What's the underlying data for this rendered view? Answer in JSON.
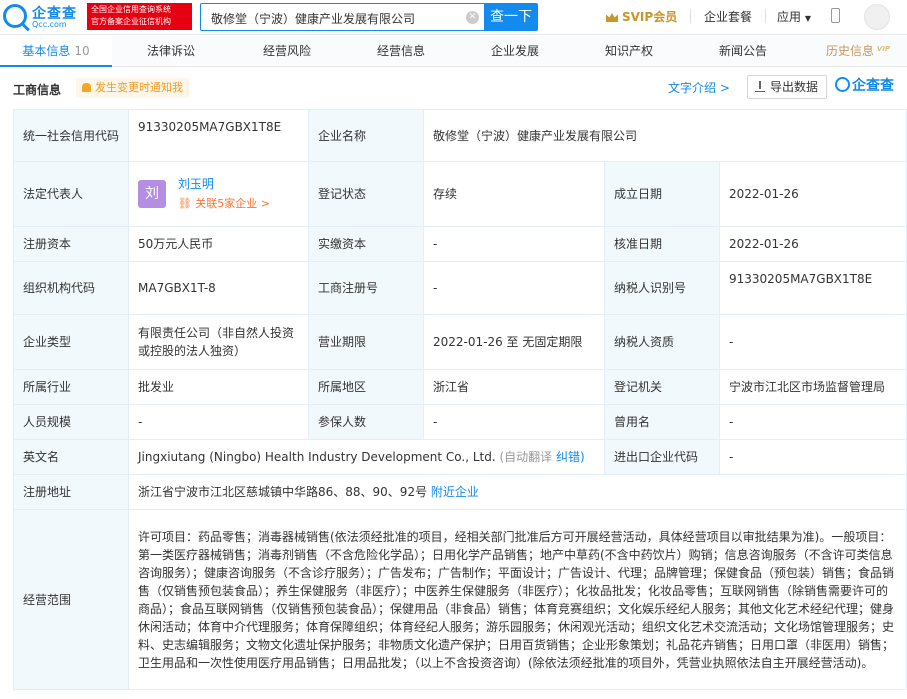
{
  "header": {
    "logo_name": "企查查",
    "logo_sub": "Qcc.com",
    "badge_line1": "全国企业信用查询系统",
    "badge_line2": "官方备案企业征信机构",
    "search_value": "敬修堂（宁波）健康产业发展有限公司",
    "search_button": "查一下",
    "svip": "SVIP会员",
    "enterprise_suite": "企业套餐",
    "apps": "应用"
  },
  "tabs": [
    {
      "label": "基本信息",
      "count": "10"
    },
    {
      "label": "法律诉讼"
    },
    {
      "label": "经营风险"
    },
    {
      "label": "经营信息"
    },
    {
      "label": "企业发展"
    },
    {
      "label": "知识产权"
    },
    {
      "label": "新闻公告"
    },
    {
      "label": "历史信息",
      "vip": "VIP"
    }
  ],
  "section": {
    "title": "工商信息",
    "notify": "发生变更时通知我",
    "text_intro": "文字介绍 >",
    "export": "导出数据",
    "brand": "企查查"
  },
  "info": {
    "credit_code_label": "统一社会信用代码",
    "credit_code": "91330205MA7GBX1T8E",
    "company_name_label": "企业名称",
    "company_name": "敬修堂（宁波）健康产业发展有限公司",
    "legal_rep_label": "法定代表人",
    "legal_rep_avatar": "刘",
    "legal_rep_name": "刘玉明",
    "legal_rep_related": "关联5家企业 >",
    "reg_status_label": "登记状态",
    "reg_status": "存续",
    "founded_label": "成立日期",
    "founded": "2022-01-26",
    "reg_capital_label": "注册资本",
    "reg_capital": "50万元人民币",
    "paid_capital_label": "实缴资本",
    "paid_capital": "-",
    "approved_label": "核准日期",
    "approved": "2022-01-26",
    "org_code_label": "组织机构代码",
    "org_code": "MA7GBX1T-8",
    "reg_no_label": "工商注册号",
    "reg_no": "-",
    "taxpayer_id_label": "纳税人识别号",
    "taxpayer_id": "91330205MA7GBX1T8E",
    "type_label": "企业类型",
    "type": "有限责任公司（非自然人投资或控股的法人独资）",
    "term_label": "营业期限",
    "term": "2022-01-26 至 无固定期限",
    "taxpayer_qual_label": "纳税人资质",
    "taxpayer_qual": "-",
    "industry_label": "所属行业",
    "industry": "批发业",
    "region_label": "所属地区",
    "region": "浙江省",
    "authority_label": "登记机关",
    "authority": "宁波市江北区市场监督管理局",
    "staff_label": "人员规模",
    "staff": "-",
    "insured_label": "参保人数",
    "insured": "-",
    "former_name_label": "曾用名",
    "former_name": "-",
    "english_label": "英文名",
    "english": "Jingxiutang (Ningbo) Health Industry Development Co., Ltd.",
    "english_auto": "(自动翻译",
    "english_fix": "纠错)",
    "import_export_label": "进出口企业代码",
    "import_export": "-",
    "address_label": "注册地址",
    "address": "浙江省宁波市江北区慈城镇中华路86、88、90、92号",
    "address_nearby": "附近企业",
    "scope_label": "经营范围",
    "scope": "许可项目：药品零售；消毒器械销售(依法须经批准的项目，经相关部门批准后方可开展经营活动，具体经营项目以审批结果为准)。一般项目：第一类医疗器械销售；消毒剂销售（不含危险化学品）；日用化学产品销售；地产中草药(不含中药饮片）购销；信息咨询服务（不含许可类信息咨询服务）；健康咨询服务（不含诊疗服务）；广告发布；广告制作；平面设计；广告设计、代理；品牌管理；保健食品（预包装）销售；食品销售（仅销售预包装食品）；养生保健服务（非医疗）；中医养生保健服务（非医疗）；化妆品批发；化妆品零售；互联网销售（除销售需要许可的商品）；食品互联网销售（仅销售预包装食品）；保健用品（非食品）销售；体育竞赛组织；文化娱乐经纪人服务；其他文化艺术经纪代理；健身休闲活动；体育中介代理服务；体育保障组织；体育经纪人服务；游乐园服务；休闲观光活动；组织文化艺术交流活动；文化场馆管理服务；史料、史志编辑服务；文物文化遗址保护服务；非物质文化遗产保护；日用百货销售；企业形象策划；礼品花卉销售；日用口罩（非医用）销售；卫生用品和一次性使用医疗用品销售；日用品批发；（以上不含投资咨询）(除依法须经批准的项目外，凭营业执照依法自主开展经营活动)。"
  }
}
